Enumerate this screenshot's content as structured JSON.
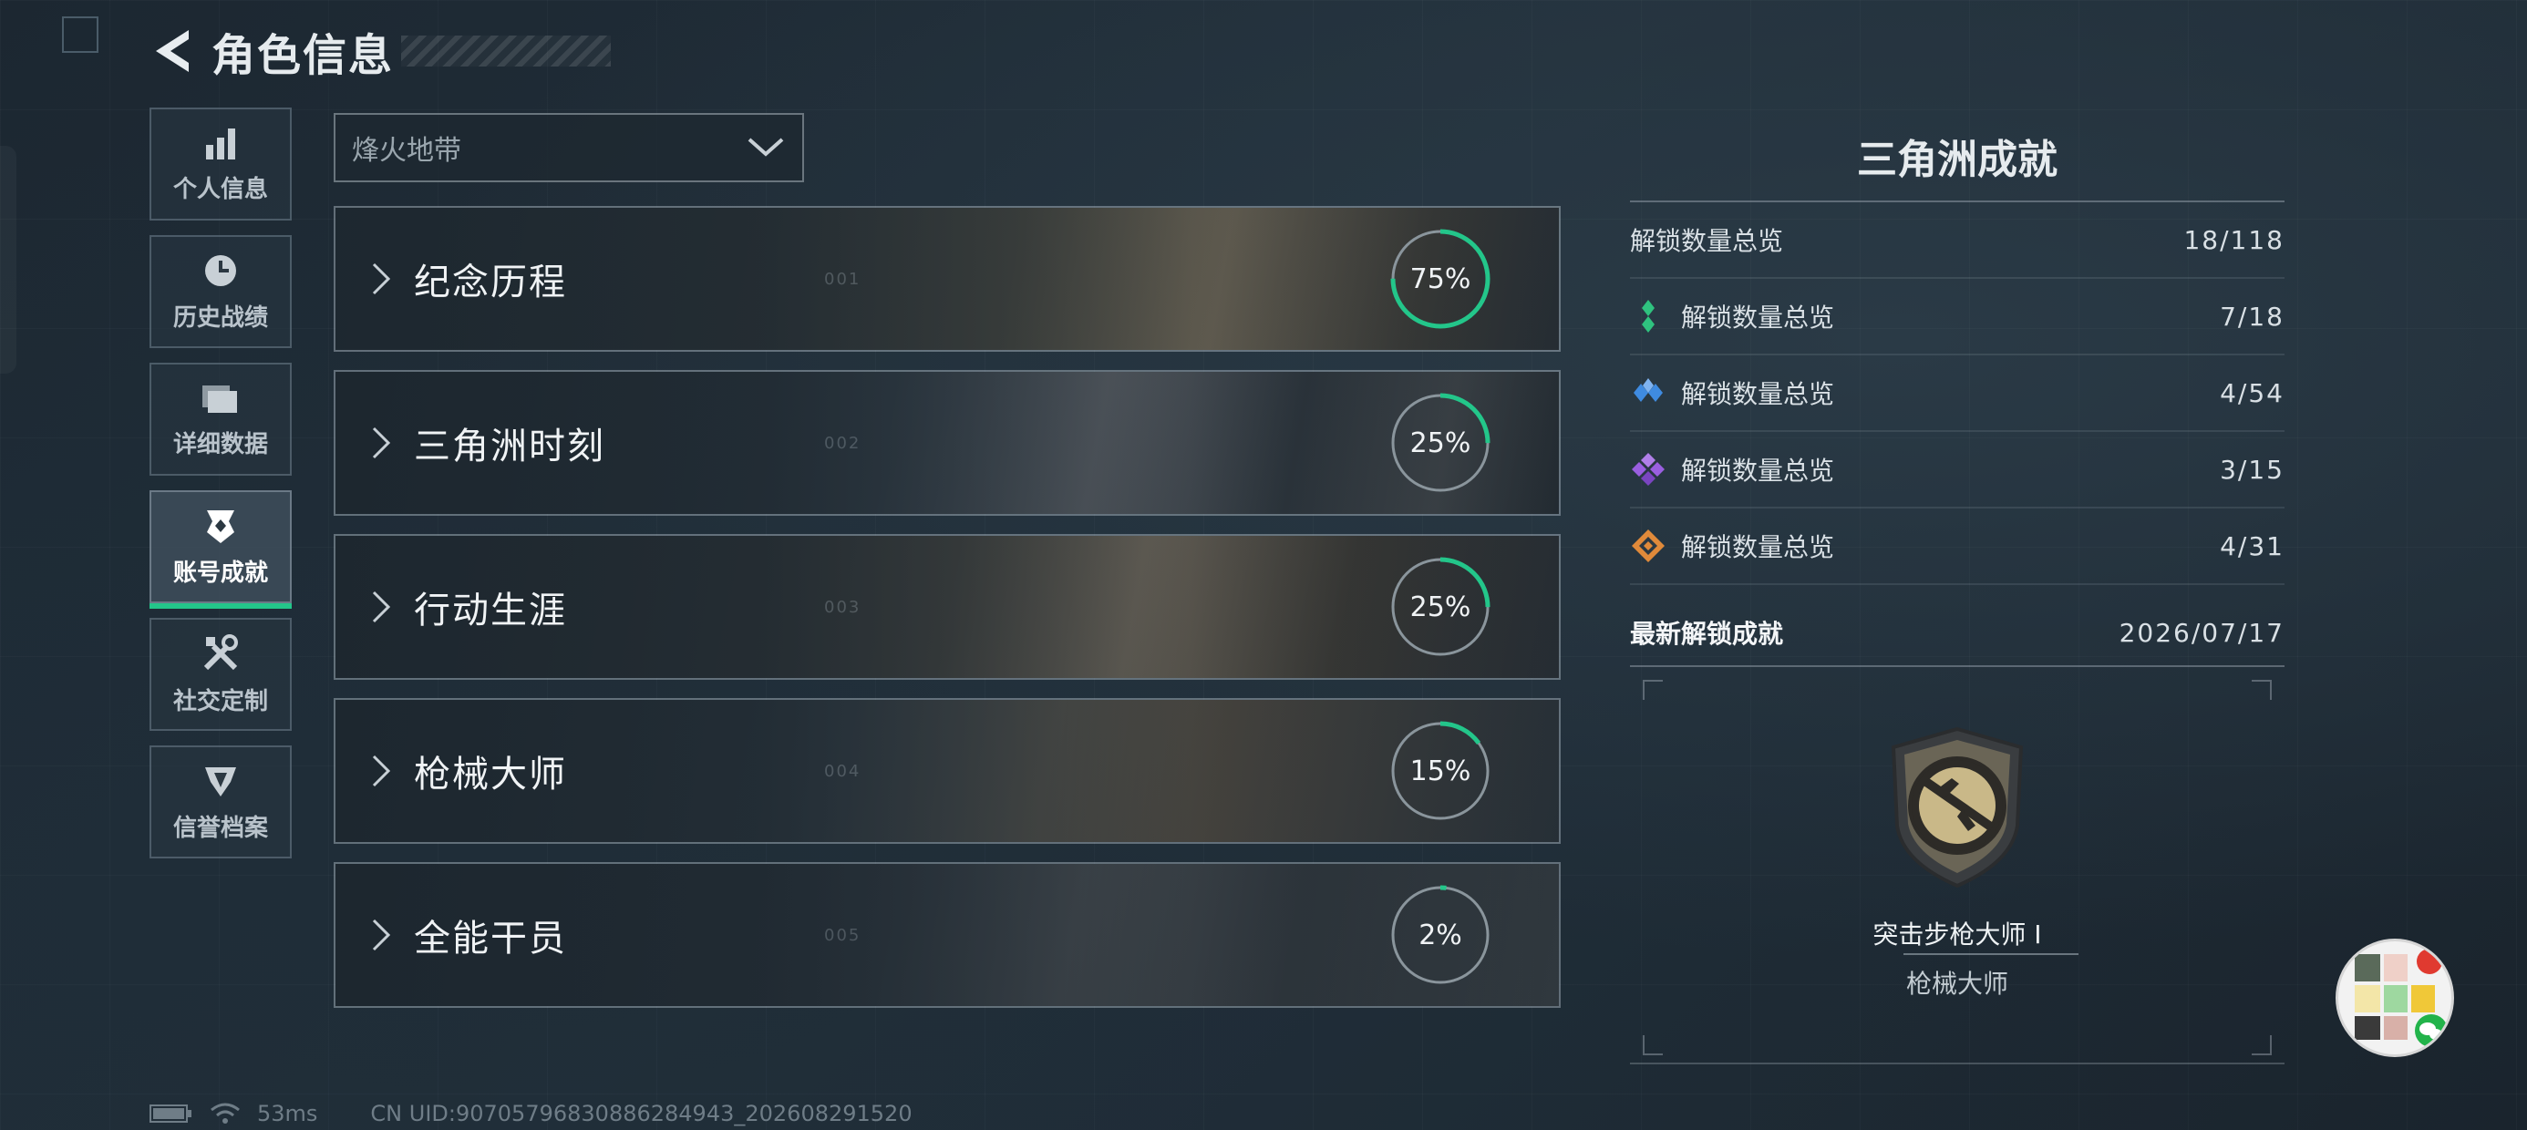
{
  "header": {
    "title": "角色信息"
  },
  "sidebar": {
    "items": [
      {
        "label": "个人信息",
        "icon": "bar-chart-icon",
        "active": false
      },
      {
        "label": "历史战绩",
        "icon": "history-clock-icon",
        "active": false
      },
      {
        "label": "详细数据",
        "icon": "folder-icon",
        "active": false
      },
      {
        "label": "账号成就",
        "icon": "achievement-badge-icon",
        "active": true
      },
      {
        "label": "社交定制",
        "icon": "tools-icon",
        "active": false
      },
      {
        "label": "信誉档案",
        "icon": "reputation-icon",
        "active": false
      }
    ]
  },
  "mode_select": {
    "value": "烽火地带"
  },
  "categories": [
    {
      "title": "纪念历程",
      "number": "001",
      "percent_label": "75%",
      "progress": 0.75
    },
    {
      "title": "三角洲时刻",
      "number": "002",
      "percent_label": "25%",
      "progress": 0.25
    },
    {
      "title": "行动生涯",
      "number": "003",
      "percent_label": "25%",
      "progress": 0.25
    },
    {
      "title": "枪械大师",
      "number": "004",
      "percent_label": "15%",
      "progress": 0.15
    },
    {
      "title": "全能干员",
      "number": "005",
      "percent_label": "2%",
      "progress": 0.02
    }
  ],
  "panel": {
    "title": "三角洲成就",
    "total": {
      "label": "解锁数量总览",
      "value": "18/118"
    },
    "tiers": [
      {
        "label": "解锁数量总览",
        "value": "7/18",
        "color": "#2fc27f"
      },
      {
        "label": "解锁数量总览",
        "value": "4/54",
        "color": "#3f8be0"
      },
      {
        "label": "解锁数量总览",
        "value": "3/15",
        "color": "#9a5fe0"
      },
      {
        "label": "解锁数量总览",
        "value": "4/31",
        "color": "#e08a3a"
      }
    ],
    "latest": {
      "label": "最新解锁成就",
      "date": "2026/07/17",
      "badge_name": "突击步枪大师 I",
      "badge_category": "枪械大师"
    }
  },
  "footer": {
    "ping": "53ms",
    "uid": "CN UID:9070579683088628494​3_202608291520"
  },
  "colors": {
    "accent": "#23c68a",
    "ring_track": "#8a959c"
  }
}
